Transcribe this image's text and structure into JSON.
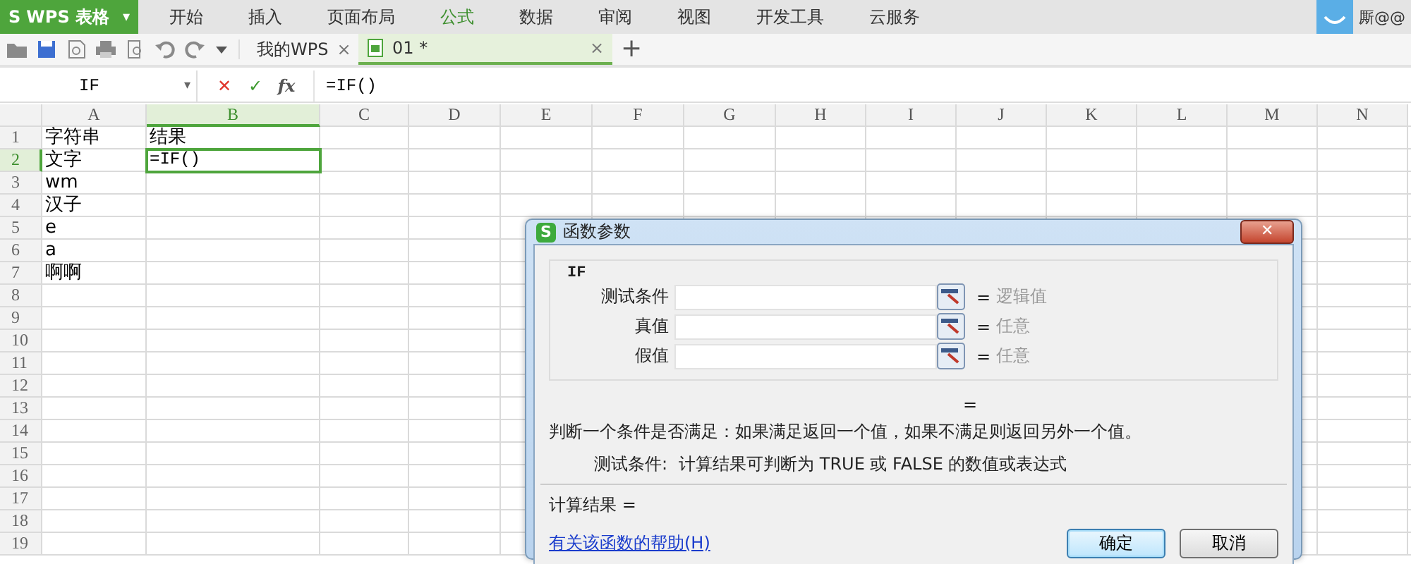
{
  "app_menu": {
    "logo": "S",
    "title": "WPS 表格",
    "caret": "▾"
  },
  "menu_tabs": [
    {
      "label": "开始",
      "selected": false
    },
    {
      "label": "插入",
      "selected": false
    },
    {
      "label": "页面布局",
      "selected": false
    },
    {
      "label": "公式",
      "selected": true
    },
    {
      "label": "数据",
      "selected": false
    },
    {
      "label": "审阅",
      "selected": false
    },
    {
      "label": "视图",
      "selected": false
    },
    {
      "label": "开发工具",
      "selected": false
    },
    {
      "label": "云服务",
      "selected": false
    }
  ],
  "user": {
    "name": "厮@@"
  },
  "doc_tabs": [
    {
      "label": "我的WPS",
      "selected": false,
      "close": "×"
    },
    {
      "label": "01 *",
      "selected": true,
      "close": "×"
    }
  ],
  "new_tab": "+",
  "formula_bar": {
    "name_box": "IF",
    "name_caret": "▾",
    "cancel": "✕",
    "confirm": "✓",
    "fx": "fx",
    "formula": "=IF()"
  },
  "grid": {
    "columns": [
      {
        "label": "A",
        "selected": false
      },
      {
        "label": "B",
        "selected": true
      },
      {
        "label": "C",
        "selected": false
      },
      {
        "label": "D",
        "selected": false
      },
      {
        "label": "E",
        "selected": false
      },
      {
        "label": "F",
        "selected": false
      },
      {
        "label": "G",
        "selected": false
      },
      {
        "label": "H",
        "selected": false
      },
      {
        "label": "I",
        "selected": false
      },
      {
        "label": "J",
        "selected": false
      },
      {
        "label": "K",
        "selected": false
      },
      {
        "label": "L",
        "selected": false
      },
      {
        "label": "M",
        "selected": false
      },
      {
        "label": "N",
        "selected": false
      }
    ],
    "rows": [
      {
        "header": "1",
        "selected": false,
        "cells": [
          {
            "text": "字符串",
            "selected": false
          },
          {
            "text": "结果",
            "selected": false
          }
        ]
      },
      {
        "header": "2",
        "selected": true,
        "cells": [
          {
            "text": "文字",
            "selected": false
          },
          {
            "text": "=IF()",
            "selected": true
          }
        ]
      },
      {
        "header": "3",
        "selected": false,
        "cells": [
          {
            "text": "wm",
            "selected": false
          }
        ]
      },
      {
        "header": "4",
        "selected": false,
        "cells": [
          {
            "text": "汉子",
            "selected": false
          }
        ]
      },
      {
        "header": "5",
        "selected": false,
        "cells": [
          {
            "text": "e",
            "selected": false
          }
        ]
      },
      {
        "header": "6",
        "selected": false,
        "cells": [
          {
            "text": "a",
            "selected": false
          }
        ]
      },
      {
        "header": "7",
        "selected": false,
        "cells": [
          {
            "text": "啊啊",
            "selected": false
          }
        ]
      },
      {
        "header": "8",
        "selected": false
      },
      {
        "header": "9",
        "selected": false
      },
      {
        "header": "10",
        "selected": false
      },
      {
        "header": "11",
        "selected": false
      },
      {
        "header": "12",
        "selected": false
      },
      {
        "header": "13",
        "selected": false
      },
      {
        "header": "14",
        "selected": false
      },
      {
        "header": "15",
        "selected": false
      },
      {
        "header": "16",
        "selected": false
      },
      {
        "header": "17",
        "selected": false
      },
      {
        "header": "18",
        "selected": false
      },
      {
        "header": "19",
        "selected": false
      }
    ]
  },
  "dialog": {
    "logo": "S",
    "title": "函数参数",
    "close": "✕",
    "function_name": "IF",
    "arguments": [
      {
        "label": "测试条件",
        "equals": "=",
        "result": "逻辑值"
      },
      {
        "label": "真值",
        "equals": "=",
        "result": "任意"
      },
      {
        "label": "假值",
        "equals": "=",
        "result": "任意"
      }
    ],
    "formula_result": "=",
    "description": "判断一个条件是否满足：如果满足返回一个值，如果不满足则返回另外一个值。",
    "argument_help": {
      "label": "测试条件:",
      "text": "计算结果可判断为 TRUE 或 FALSE 的数值或表达式"
    },
    "calc_result": "计算结果 =",
    "help_link": "有关该函数的帮助(H)",
    "buttons": [
      {
        "label": "确定",
        "kind": "default"
      },
      {
        "label": "取消",
        "kind": "normal"
      }
    ]
  }
}
